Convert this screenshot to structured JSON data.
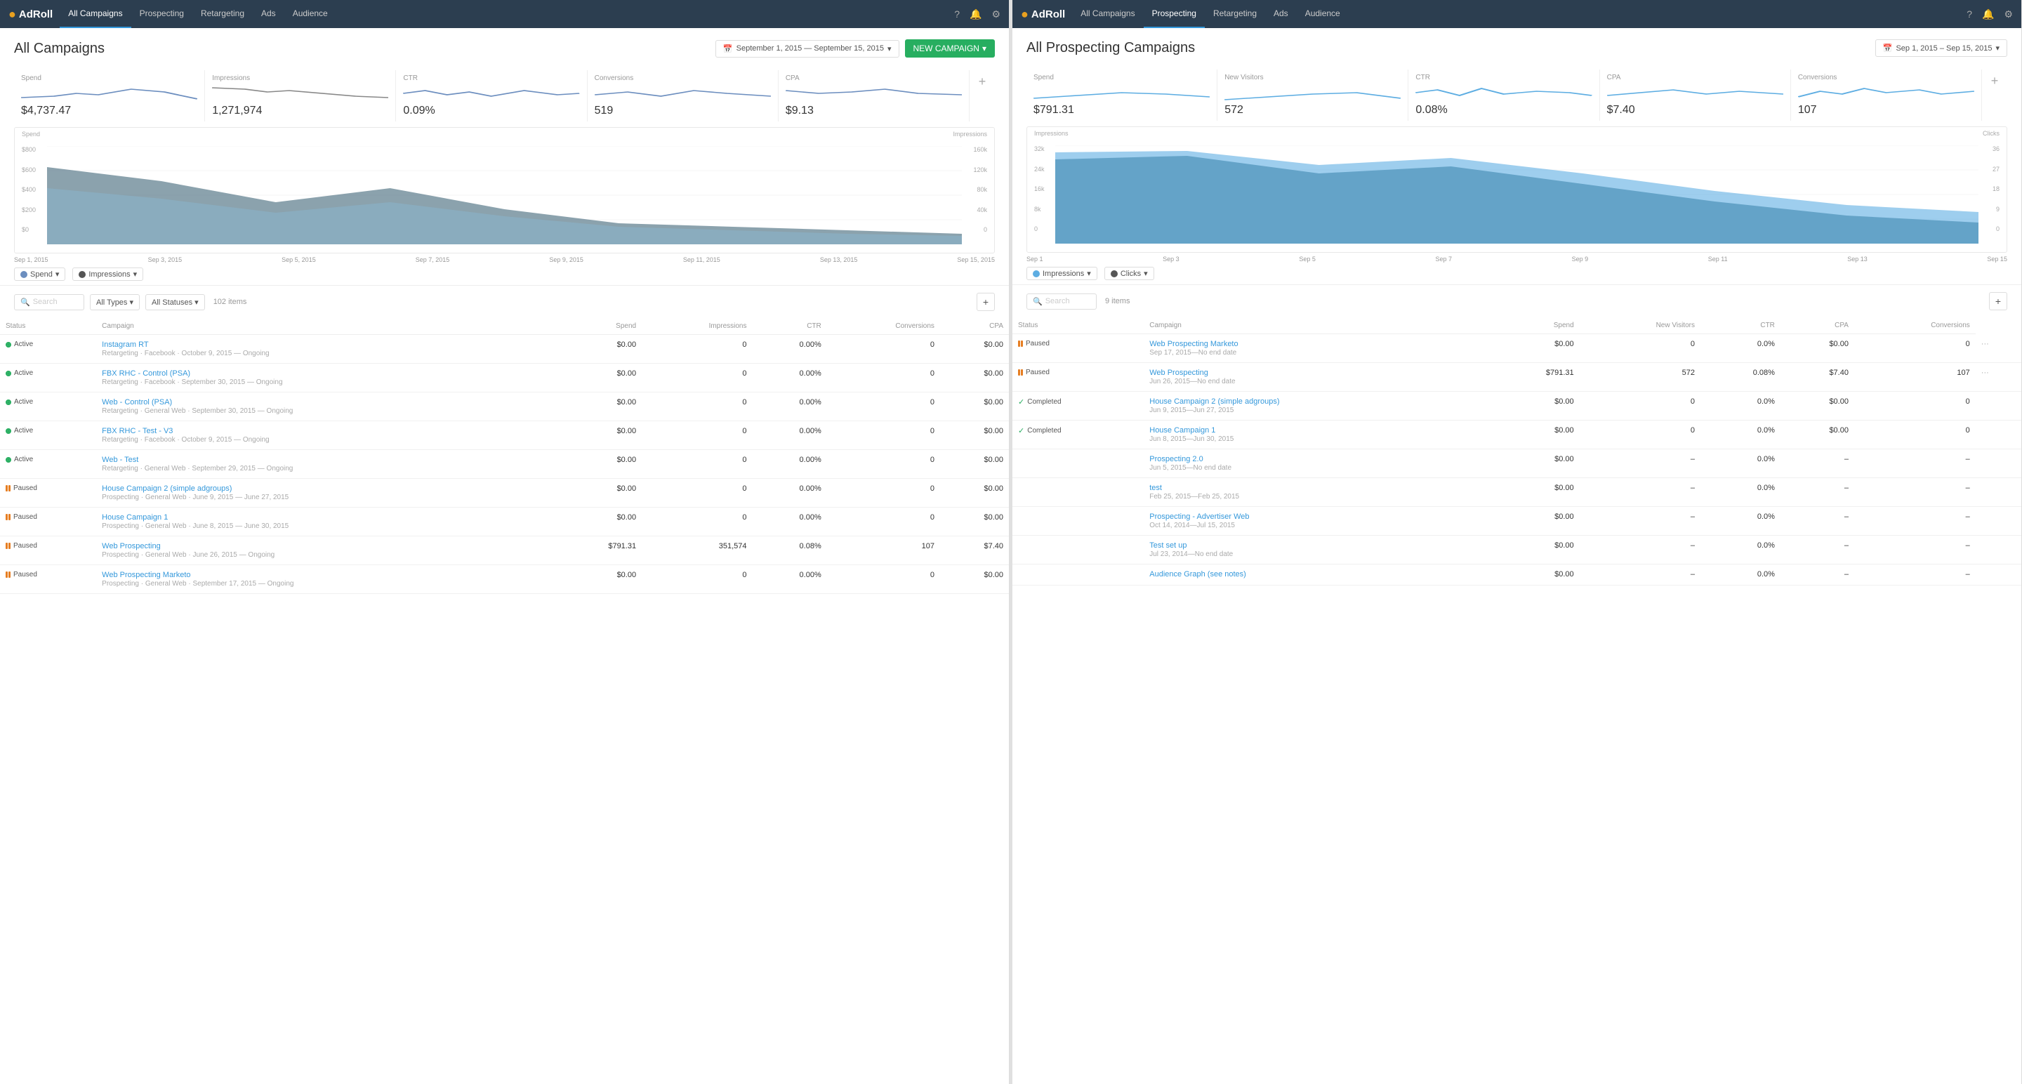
{
  "left_panel": {
    "nav": {
      "logo": "AdRoll",
      "tabs": [
        {
          "label": "All Campaigns",
          "active": true
        },
        {
          "label": "Prospecting",
          "active": false
        },
        {
          "label": "Retargeting",
          "active": false
        },
        {
          "label": "Ads",
          "active": false
        },
        {
          "label": "Audience",
          "active": false
        }
      ]
    },
    "title": "All Campaigns",
    "date_range": "September 1, 2015 — September 15, 2015",
    "new_campaign_label": "NEW CAMPAIGN",
    "stats": [
      {
        "label": "Spend",
        "value": "$4,737.47"
      },
      {
        "label": "Impressions",
        "value": "1,271,974"
      },
      {
        "label": "CTR",
        "value": "0.09%"
      },
      {
        "label": "Conversions",
        "value": "519"
      },
      {
        "label": "CPA",
        "value": "$9.13"
      }
    ],
    "chart": {
      "y_left_labels": [
        "$800",
        "$600",
        "$400",
        "$200",
        "$0"
      ],
      "y_right_labels": [
        "160k",
        "120k",
        "80k",
        "40k",
        "0"
      ],
      "y_left_header": "Spend",
      "y_right_header": "Impressions",
      "x_labels": [
        "Sep 1, 2015",
        "Sep 3, 2015",
        "Sep 5, 2015",
        "Sep 7, 2015",
        "Sep 9, 2015",
        "Sep 11, 2015",
        "Sep 13, 2015",
        "Sep 15, 2015"
      ]
    },
    "legend": [
      {
        "label": "Spend",
        "color": "#6c8ebf"
      },
      {
        "label": "Impressions",
        "color": "#555"
      }
    ],
    "table": {
      "search_placeholder": "Search",
      "filter1": "All Types",
      "filter2": "All Statuses",
      "item_count": "102 items",
      "columns": [
        "Status",
        "Campaign",
        "Spend",
        "Impressions",
        "CTR",
        "Conversions",
        "CPA"
      ],
      "rows": [
        {
          "status": "active",
          "status_label": "Active",
          "campaign_name": "Instagram RT",
          "campaign_sub": "Retargeting · Facebook · October 9, 2015 — Ongoing",
          "spend": "$0.00",
          "impressions": "0",
          "ctr": "0.00%",
          "conversions": "0",
          "cpa": "$0.00"
        },
        {
          "status": "active",
          "status_label": "Active",
          "campaign_name": "FBX RHC - Control (PSA)",
          "campaign_sub": "Retargeting · Facebook · September 30, 2015 — Ongoing",
          "spend": "$0.00",
          "impressions": "0",
          "ctr": "0.00%",
          "conversions": "0",
          "cpa": "$0.00"
        },
        {
          "status": "active",
          "status_label": "Active",
          "campaign_name": "Web - Control (PSA)",
          "campaign_sub": "Retargeting · General Web · September 30, 2015 — Ongoing",
          "spend": "$0.00",
          "impressions": "0",
          "ctr": "0.00%",
          "conversions": "0",
          "cpa": "$0.00"
        },
        {
          "status": "active",
          "status_label": "Active",
          "campaign_name": "FBX RHC - Test - V3",
          "campaign_sub": "Retargeting · Facebook · October 9, 2015 — Ongoing",
          "spend": "$0.00",
          "impressions": "0",
          "ctr": "0.00%",
          "conversions": "0",
          "cpa": "$0.00"
        },
        {
          "status": "active",
          "status_label": "Active",
          "campaign_name": "Web - Test",
          "campaign_sub": "Retargeting · General Web · September 29, 2015 — Ongoing",
          "spend": "$0.00",
          "impressions": "0",
          "ctr": "0.00%",
          "conversions": "0",
          "cpa": "$0.00"
        },
        {
          "status": "paused",
          "status_label": "Paused",
          "campaign_name": "House Campaign 2 (simple adgroups)",
          "campaign_sub": "Prospecting · General Web · June 9, 2015 — June 27, 2015",
          "spend": "$0.00",
          "impressions": "0",
          "ctr": "0.00%",
          "conversions": "0",
          "cpa": "$0.00"
        },
        {
          "status": "paused",
          "status_label": "Paused",
          "campaign_name": "House Campaign 1",
          "campaign_sub": "Prospecting · General Web · June 8, 2015 — June 30, 2015",
          "spend": "$0.00",
          "impressions": "0",
          "ctr": "0.00%",
          "conversions": "0",
          "cpa": "$0.00"
        },
        {
          "status": "paused",
          "status_label": "Paused",
          "campaign_name": "Web Prospecting",
          "campaign_sub": "Prospecting · General Web · June 26, 2015 — Ongoing",
          "spend": "$791.31",
          "impressions": "351,574",
          "ctr": "0.08%",
          "conversions": "107",
          "cpa": "$7.40"
        },
        {
          "status": "paused",
          "status_label": "Paused",
          "campaign_name": "Web Prospecting Marketo",
          "campaign_sub": "Prospecting · General Web · September 17, 2015 — Ongoing",
          "spend": "$0.00",
          "impressions": "0",
          "ctr": "0.00%",
          "conversions": "0",
          "cpa": "$0.00"
        }
      ]
    }
  },
  "right_panel": {
    "nav": {
      "logo": "AdRoll",
      "tabs": [
        {
          "label": "All Campaigns",
          "active": false
        },
        {
          "label": "Prospecting",
          "active": true
        },
        {
          "label": "Retargeting",
          "active": false
        },
        {
          "label": "Ads",
          "active": false
        },
        {
          "label": "Audience",
          "active": false
        }
      ]
    },
    "title": "All Prospecting Campaigns",
    "date_range": "Sep 1, 2015 – Sep 15, 2015",
    "stats": [
      {
        "label": "Spend",
        "value": "$791.31"
      },
      {
        "label": "New Visitors",
        "value": "572"
      },
      {
        "label": "CTR",
        "value": "0.08%"
      },
      {
        "label": "CPA",
        "value": "$7.40"
      },
      {
        "label": "Conversions",
        "value": "107"
      }
    ],
    "chart": {
      "y_left_labels": [
        "32k",
        "24k",
        "16k",
        "8k",
        "0"
      ],
      "y_right_labels": [
        "36",
        "27",
        "18",
        "9",
        "0"
      ],
      "y_left_header": "Impressions",
      "y_right_header": "Clicks",
      "x_labels": [
        "Sep 1",
        "Sep 3",
        "Sep 5",
        "Sep 7",
        "Sep 9",
        "Sep 11",
        "Sep 13",
        "Sep 15"
      ]
    },
    "legend": [
      {
        "label": "Impressions",
        "color": "#5dade2"
      },
      {
        "label": "Clicks",
        "color": "#555"
      }
    ],
    "table": {
      "search_placeholder": "Search",
      "item_count": "9 items",
      "columns": [
        "Status",
        "Campaign",
        "Spend",
        "New Visitors",
        "CTR",
        "CPA",
        "Conversions"
      ],
      "rows": [
        {
          "status": "paused",
          "status_label": "Paused",
          "campaign_name": "Web Prospecting Marketo",
          "campaign_sub": "Sep 17, 2015—No end date",
          "spend": "$0.00",
          "new_visitors": "0",
          "ctr": "0.0%",
          "cpa": "$0.00",
          "conversions": "0",
          "has_menu": true
        },
        {
          "status": "paused",
          "status_label": "Paused",
          "campaign_name": "Web Prospecting",
          "campaign_sub": "Jun 26, 2015—No end date",
          "spend": "$791.31",
          "new_visitors": "572",
          "ctr": "0.08%",
          "cpa": "$7.40",
          "conversions": "107",
          "has_menu": true
        },
        {
          "status": "completed",
          "status_label": "Completed",
          "campaign_name": "House Campaign 2 (simple adgroups)",
          "campaign_sub": "Jun 9, 2015—Jun 27, 2015",
          "spend": "$0.00",
          "new_visitors": "0",
          "ctr": "0.0%",
          "cpa": "$0.00",
          "conversions": "0",
          "has_menu": false
        },
        {
          "status": "completed",
          "status_label": "Completed",
          "campaign_name": "House Campaign 1",
          "campaign_sub": "Jun 8, 2015—Jun 30, 2015",
          "spend": "$0.00",
          "new_visitors": "0",
          "ctr": "0.0%",
          "cpa": "$0.00",
          "conversions": "0",
          "has_menu": false
        },
        {
          "status": "none",
          "status_label": "",
          "campaign_name": "Prospecting 2.0",
          "campaign_sub": "Jun 5, 2015—No end date",
          "spend": "$0.00",
          "new_visitors": "–",
          "ctr": "0.0%",
          "cpa": "–",
          "conversions": "–",
          "has_menu": false
        },
        {
          "status": "none",
          "status_label": "",
          "campaign_name": "test",
          "campaign_sub": "Feb 25, 2015—Feb 25, 2015",
          "spend": "$0.00",
          "new_visitors": "–",
          "ctr": "0.0%",
          "cpa": "–",
          "conversions": "–",
          "has_menu": false
        },
        {
          "status": "none",
          "status_label": "",
          "campaign_name": "Prospecting - Advertiser Web",
          "campaign_sub": "Oct 14, 2014—Jul 15, 2015",
          "spend": "$0.00",
          "new_visitors": "–",
          "ctr": "0.0%",
          "cpa": "–",
          "conversions": "–",
          "has_menu": false
        },
        {
          "status": "none",
          "status_label": "",
          "campaign_name": "Test set up",
          "campaign_sub": "Jul 23, 2014—No end date",
          "spend": "$0.00",
          "new_visitors": "–",
          "ctr": "0.0%",
          "cpa": "–",
          "conversions": "–",
          "has_menu": false
        },
        {
          "status": "none",
          "status_label": "",
          "campaign_name": "Audience Graph (see notes)",
          "campaign_sub": "",
          "spend": "$0.00",
          "new_visitors": "–",
          "ctr": "0.0%",
          "cpa": "–",
          "conversions": "–",
          "has_menu": false
        }
      ]
    }
  }
}
